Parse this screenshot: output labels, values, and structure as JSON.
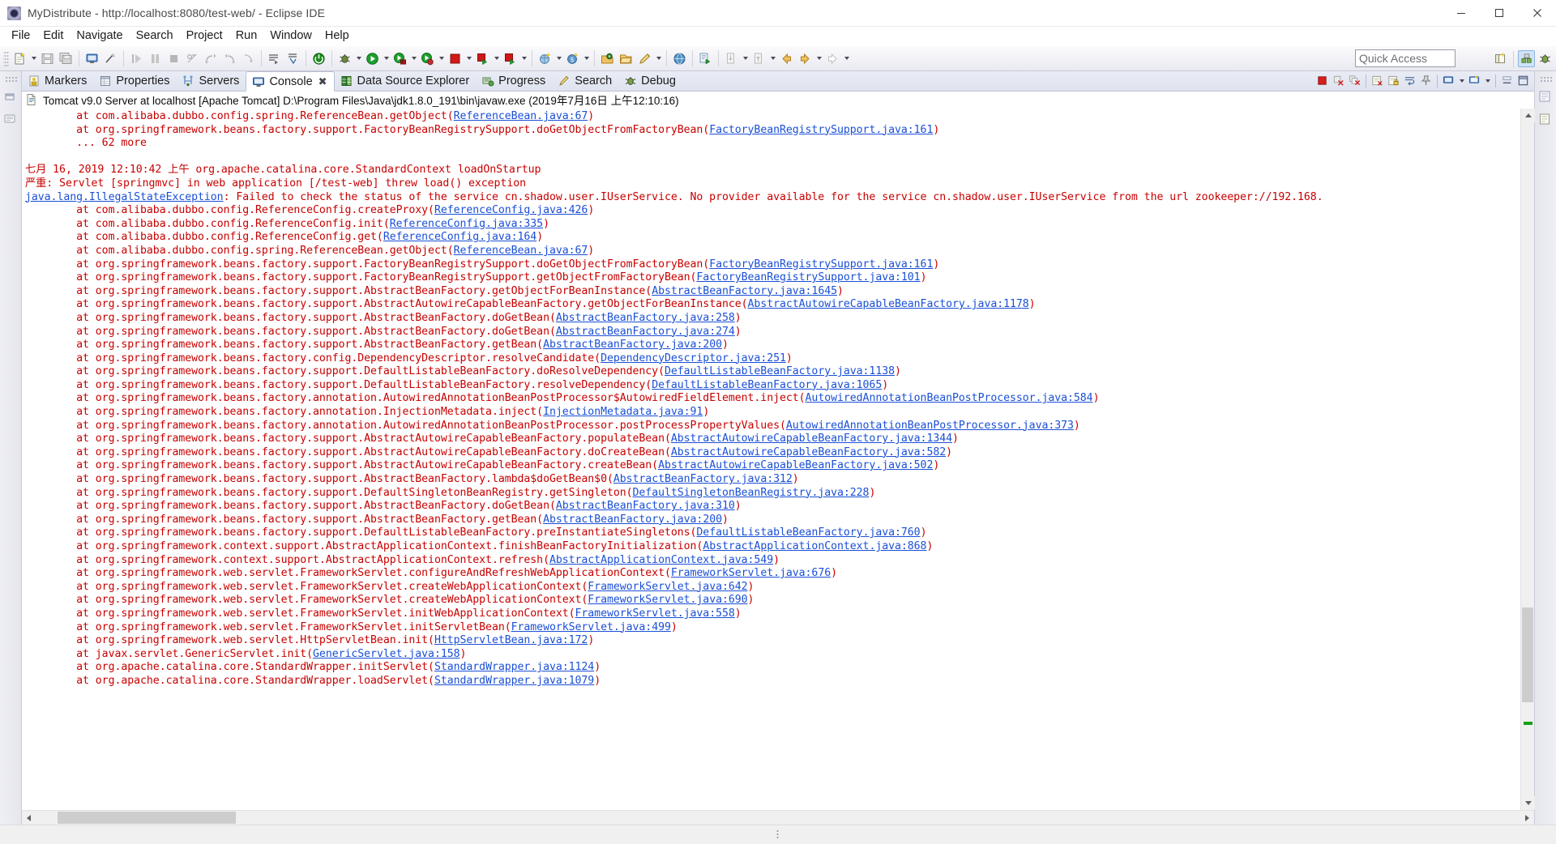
{
  "window": {
    "title": "MyDistribute - http://localhost:8080/test-web/ - Eclipse IDE",
    "icon": "eclipse-icon",
    "minimize_label": "—",
    "maximize_label": "❐",
    "close_label": "✕"
  },
  "menu": {
    "items": [
      {
        "label": "File"
      },
      {
        "label": "Edit"
      },
      {
        "label": "Navigate"
      },
      {
        "label": "Search"
      },
      {
        "label": "Project"
      },
      {
        "label": "Run"
      },
      {
        "label": "Window"
      },
      {
        "label": "Help"
      }
    ]
  },
  "toolbar": {
    "quick_access_placeholder": "Quick Access",
    "quick_access_value": "",
    "groups": [
      {
        "icons": [
          "new-wizard-icon",
          "dropdown-arrow",
          "save-icon",
          "save-all-icon"
        ]
      },
      {
        "icons": [
          "console-icon",
          "no-publish-icon"
        ]
      },
      {
        "icons": [
          "step-into-icon",
          "pause-icon",
          "terminate-icon",
          "skip-breakpoints-icon",
          "step-over-icon",
          "step-return-icon",
          "drop-to-frame-icon"
        ]
      },
      {
        "icons": [
          "open-task-icon",
          "link-task-icon"
        ]
      },
      {
        "icons": [
          "power-server-icon"
        ]
      },
      {
        "icons": [
          "debug-bug-icon",
          "dropdown-arrow",
          "run-green-icon",
          "dropdown-arrow",
          "run-on-server-icon",
          "dropdown-arrow",
          "profile-icon",
          "dropdown-arrow",
          "stop-red-icon",
          "dropdown-arrow",
          "publish-icon",
          "dropdown-arrow",
          "server-run-icon",
          "dropdown-arrow"
        ]
      },
      {
        "icons": [
          "new-java-class-icon",
          "dropdown-arrow",
          "new-dollar-icon",
          "dropdown-arrow"
        ]
      },
      {
        "icons": [
          "open-type-icon",
          "open-folder-icon",
          "pencil-icon",
          "dropdown-arrow"
        ]
      },
      {
        "icons": [
          "web-browser-icon"
        ]
      },
      {
        "icons": [
          "external-tools-icon"
        ]
      },
      {
        "icons": [
          "prev-annotation-icon",
          "dropdown-arrow",
          "next-annotation-icon",
          "dropdown-arrow",
          "back-arrow-icon",
          "forward-arrow-icon",
          "dropdown-arrow",
          "next-edit-icon",
          "dropdown-arrow"
        ]
      }
    ],
    "right_icons": [
      "open-perspective-icon",
      "java-ee-perspective-icon",
      "debug-perspective-icon"
    ]
  },
  "tabs": {
    "items": [
      {
        "label": "Markers",
        "icon": "markers-icon",
        "active": false
      },
      {
        "label": "Properties",
        "icon": "properties-icon",
        "active": false
      },
      {
        "label": "Servers",
        "icon": "servers-icon",
        "active": false
      },
      {
        "label": "Console",
        "icon": "console-view-icon",
        "active": true,
        "close": "✖"
      },
      {
        "label": "Data Source Explorer",
        "icon": "datasource-icon",
        "active": false
      },
      {
        "label": "Progress",
        "icon": "progress-icon",
        "active": false
      },
      {
        "label": "Search",
        "icon": "search-icon",
        "active": false
      },
      {
        "label": "Debug",
        "icon": "debug-icon",
        "active": false
      }
    ],
    "view_toolbar": [
      "terminate-icon",
      "remove-launch-icon",
      "remove-all-terminated-icon",
      "clear-console-icon",
      "scroll-lock-icon",
      "word-wrap-icon",
      "pin-console-icon",
      "display-selected-console-icon",
      "dropdown-arrow",
      "open-console-icon",
      "dropdown-arrow",
      "minimize-icon",
      "maximize-icon"
    ]
  },
  "console": {
    "header": "Tomcat v9.0 Server at localhost [Apache Tomcat] D:\\Program Files\\Java\\jdk1.8.0_191\\bin\\javaw.exe (2019年7月16日 上午12:10:16)",
    "header_icon": "console-document-icon",
    "lines": [
      {
        "indent": 1,
        "segments": [
          {
            "t": "at com.alibaba.dubbo.config.spring.ReferenceBean.getObject("
          },
          {
            "t": "ReferenceBean.java:67",
            "link": true
          },
          {
            "t": ")"
          }
        ]
      },
      {
        "indent": 1,
        "segments": [
          {
            "t": "at org.springframework.beans.factory.support.FactoryBeanRegistrySupport.doGetObjectFromFactoryBean("
          },
          {
            "t": "FactoryBeanRegistrySupport.java:161",
            "link": true
          },
          {
            "t": ")"
          }
        ]
      },
      {
        "indent": 1,
        "segments": [
          {
            "t": "... 62 more"
          }
        ]
      },
      {
        "indent": 0,
        "segments": [
          {
            "t": " "
          }
        ]
      },
      {
        "indent": 0,
        "segments": [
          {
            "t": "七月 16, 2019 12:10:42 上午 org.apache.catalina.core.StandardContext loadOnStartup"
          }
        ]
      },
      {
        "indent": 0,
        "segments": [
          {
            "t": "严重: Servlet [springmvc] in web application [/test-web] threw load() exception"
          }
        ]
      },
      {
        "indent": 0,
        "segments": [
          {
            "t": "java.lang.IllegalStateException",
            "link": true
          },
          {
            "t": ": Failed to check the status of the service cn.shadow.user.IUserService. No provider available for the service cn.shadow.user.IUserService from the url zookeeper://192.168."
          }
        ]
      },
      {
        "indent": 1,
        "segments": [
          {
            "t": "at com.alibaba.dubbo.config.ReferenceConfig.createProxy("
          },
          {
            "t": "ReferenceConfig.java:426",
            "link": true
          },
          {
            "t": ")"
          }
        ]
      },
      {
        "indent": 1,
        "segments": [
          {
            "t": "at com.alibaba.dubbo.config.ReferenceConfig.init("
          },
          {
            "t": "ReferenceConfig.java:335",
            "link": true
          },
          {
            "t": ")"
          }
        ]
      },
      {
        "indent": 1,
        "segments": [
          {
            "t": "at com.alibaba.dubbo.config.ReferenceConfig.get("
          },
          {
            "t": "ReferenceConfig.java:164",
            "link": true
          },
          {
            "t": ")"
          }
        ]
      },
      {
        "indent": 1,
        "segments": [
          {
            "t": "at com.alibaba.dubbo.config.spring.ReferenceBean.getObject("
          },
          {
            "t": "ReferenceBean.java:67",
            "link": true
          },
          {
            "t": ")"
          }
        ]
      },
      {
        "indent": 1,
        "segments": [
          {
            "t": "at org.springframework.beans.factory.support.FactoryBeanRegistrySupport.doGetObjectFromFactoryBean("
          },
          {
            "t": "FactoryBeanRegistrySupport.java:161",
            "link": true
          },
          {
            "t": ")"
          }
        ]
      },
      {
        "indent": 1,
        "segments": [
          {
            "t": "at org.springframework.beans.factory.support.FactoryBeanRegistrySupport.getObjectFromFactoryBean("
          },
          {
            "t": "FactoryBeanRegistrySupport.java:101",
            "link": true
          },
          {
            "t": ")"
          }
        ]
      },
      {
        "indent": 1,
        "segments": [
          {
            "t": "at org.springframework.beans.factory.support.AbstractBeanFactory.getObjectForBeanInstance("
          },
          {
            "t": "AbstractBeanFactory.java:1645",
            "link": true
          },
          {
            "t": ")"
          }
        ]
      },
      {
        "indent": 1,
        "segments": [
          {
            "t": "at org.springframework.beans.factory.support.AbstractAutowireCapableBeanFactory.getObjectForBeanInstance("
          },
          {
            "t": "AbstractAutowireCapableBeanFactory.java:1178",
            "link": true
          },
          {
            "t": ")"
          }
        ]
      },
      {
        "indent": 1,
        "segments": [
          {
            "t": "at org.springframework.beans.factory.support.AbstractBeanFactory.doGetBean("
          },
          {
            "t": "AbstractBeanFactory.java:258",
            "link": true
          },
          {
            "t": ")"
          }
        ]
      },
      {
        "indent": 1,
        "segments": [
          {
            "t": "at org.springframework.beans.factory.support.AbstractBeanFactory.doGetBean("
          },
          {
            "t": "AbstractBeanFactory.java:274",
            "link": true
          },
          {
            "t": ")"
          }
        ]
      },
      {
        "indent": 1,
        "segments": [
          {
            "t": "at org.springframework.beans.factory.support.AbstractBeanFactory.getBean("
          },
          {
            "t": "AbstractBeanFactory.java:200",
            "link": true
          },
          {
            "t": ")"
          }
        ]
      },
      {
        "indent": 1,
        "segments": [
          {
            "t": "at org.springframework.beans.factory.config.DependencyDescriptor.resolveCandidate("
          },
          {
            "t": "DependencyDescriptor.java:251",
            "link": true
          },
          {
            "t": ")"
          }
        ]
      },
      {
        "indent": 1,
        "segments": [
          {
            "t": "at org.springframework.beans.factory.support.DefaultListableBeanFactory.doResolveDependency("
          },
          {
            "t": "DefaultListableBeanFactory.java:1138",
            "link": true
          },
          {
            "t": ")"
          }
        ]
      },
      {
        "indent": 1,
        "segments": [
          {
            "t": "at org.springframework.beans.factory.support.DefaultListableBeanFactory.resolveDependency("
          },
          {
            "t": "DefaultListableBeanFactory.java:1065",
            "link": true
          },
          {
            "t": ")"
          }
        ]
      },
      {
        "indent": 1,
        "segments": [
          {
            "t": "at org.springframework.beans.factory.annotation.AutowiredAnnotationBeanPostProcessor$AutowiredFieldElement.inject("
          },
          {
            "t": "AutowiredAnnotationBeanPostProcessor.java:584",
            "link": true
          },
          {
            "t": ")"
          }
        ]
      },
      {
        "indent": 1,
        "segments": [
          {
            "t": "at org.springframework.beans.factory.annotation.InjectionMetadata.inject("
          },
          {
            "t": "InjectionMetadata.java:91",
            "link": true
          },
          {
            "t": ")"
          }
        ]
      },
      {
        "indent": 1,
        "segments": [
          {
            "t": "at org.springframework.beans.factory.annotation.AutowiredAnnotationBeanPostProcessor.postProcessPropertyValues("
          },
          {
            "t": "AutowiredAnnotationBeanPostProcessor.java:373",
            "link": true
          },
          {
            "t": ")"
          }
        ]
      },
      {
        "indent": 1,
        "segments": [
          {
            "t": "at org.springframework.beans.factory.support.AbstractAutowireCapableBeanFactory.populateBean("
          },
          {
            "t": "AbstractAutowireCapableBeanFactory.java:1344",
            "link": true
          },
          {
            "t": ")"
          }
        ]
      },
      {
        "indent": 1,
        "segments": [
          {
            "t": "at org.springframework.beans.factory.support.AbstractAutowireCapableBeanFactory.doCreateBean("
          },
          {
            "t": "AbstractAutowireCapableBeanFactory.java:582",
            "link": true
          },
          {
            "t": ")"
          }
        ]
      },
      {
        "indent": 1,
        "segments": [
          {
            "t": "at org.springframework.beans.factory.support.AbstractAutowireCapableBeanFactory.createBean("
          },
          {
            "t": "AbstractAutowireCapableBeanFactory.java:502",
            "link": true
          },
          {
            "t": ")"
          }
        ]
      },
      {
        "indent": 1,
        "segments": [
          {
            "t": "at org.springframework.beans.factory.support.AbstractBeanFactory.lambda$doGetBean$0("
          },
          {
            "t": "AbstractBeanFactory.java:312",
            "link": true
          },
          {
            "t": ")"
          }
        ]
      },
      {
        "indent": 1,
        "segments": [
          {
            "t": "at org.springframework.beans.factory.support.DefaultSingletonBeanRegistry.getSingleton("
          },
          {
            "t": "DefaultSingletonBeanRegistry.java:228",
            "link": true
          },
          {
            "t": ")"
          }
        ]
      },
      {
        "indent": 1,
        "segments": [
          {
            "t": "at org.springframework.beans.factory.support.AbstractBeanFactory.doGetBean("
          },
          {
            "t": "AbstractBeanFactory.java:310",
            "link": true
          },
          {
            "t": ")"
          }
        ]
      },
      {
        "indent": 1,
        "segments": [
          {
            "t": "at org.springframework.beans.factory.support.AbstractBeanFactory.getBean("
          },
          {
            "t": "AbstractBeanFactory.java:200",
            "link": true
          },
          {
            "t": ")"
          }
        ]
      },
      {
        "indent": 1,
        "segments": [
          {
            "t": "at org.springframework.beans.factory.support.DefaultListableBeanFactory.preInstantiateSingletons("
          },
          {
            "t": "DefaultListableBeanFactory.java:760",
            "link": true
          },
          {
            "t": ")"
          }
        ]
      },
      {
        "indent": 1,
        "segments": [
          {
            "t": "at org.springframework.context.support.AbstractApplicationContext.finishBeanFactoryInitialization("
          },
          {
            "t": "AbstractApplicationContext.java:868",
            "link": true
          },
          {
            "t": ")"
          }
        ]
      },
      {
        "indent": 1,
        "segments": [
          {
            "t": "at org.springframework.context.support.AbstractApplicationContext.refresh("
          },
          {
            "t": "AbstractApplicationContext.java:549",
            "link": true
          },
          {
            "t": ")"
          }
        ]
      },
      {
        "indent": 1,
        "segments": [
          {
            "t": "at org.springframework.web.servlet.FrameworkServlet.configureAndRefreshWebApplicationContext("
          },
          {
            "t": "FrameworkServlet.java:676",
            "link": true
          },
          {
            "t": ")"
          }
        ]
      },
      {
        "indent": 1,
        "segments": [
          {
            "t": "at org.springframework.web.servlet.FrameworkServlet.createWebApplicationContext("
          },
          {
            "t": "FrameworkServlet.java:642",
            "link": true
          },
          {
            "t": ")"
          }
        ]
      },
      {
        "indent": 1,
        "segments": [
          {
            "t": "at org.springframework.web.servlet.FrameworkServlet.createWebApplicationContext("
          },
          {
            "t": "FrameworkServlet.java:690",
            "link": true
          },
          {
            "t": ")"
          }
        ]
      },
      {
        "indent": 1,
        "segments": [
          {
            "t": "at org.springframework.web.servlet.FrameworkServlet.initWebApplicationContext("
          },
          {
            "t": "FrameworkServlet.java:558",
            "link": true
          },
          {
            "t": ")"
          }
        ]
      },
      {
        "indent": 1,
        "segments": [
          {
            "t": "at org.springframework.web.servlet.FrameworkServlet.initServletBean("
          },
          {
            "t": "FrameworkServlet.java:499",
            "link": true
          },
          {
            "t": ")"
          }
        ]
      },
      {
        "indent": 1,
        "segments": [
          {
            "t": "at org.springframework.web.servlet.HttpServletBean.init("
          },
          {
            "t": "HttpServletBean.java:172",
            "link": true
          },
          {
            "t": ")"
          }
        ]
      },
      {
        "indent": 1,
        "segments": [
          {
            "t": "at javax.servlet.GenericServlet.init("
          },
          {
            "t": "GenericServlet.java:158",
            "link": true
          },
          {
            "t": ")"
          }
        ]
      },
      {
        "indent": 1,
        "segments": [
          {
            "t": "at org.apache.catalina.core.StandardWrapper.initServlet("
          },
          {
            "t": "StandardWrapper.java:1124",
            "link": true
          },
          {
            "t": ")"
          }
        ]
      },
      {
        "indent": 1,
        "clipped": true,
        "segments": [
          {
            "t": "at org.apache.catalina.core.StandardWrapper.loadServlet("
          },
          {
            "t": "StandardWrapper.java:1079",
            "link": true
          },
          {
            "t": ")"
          }
        ]
      }
    ]
  },
  "scrollbars": {
    "vertical": {
      "thumb_top_pct": 72,
      "thumb_height_pct": 14,
      "marker_top_pct": 89
    },
    "horizontal": {
      "thumb_left_pct": 1.5,
      "thumb_width_pct": 12
    }
  },
  "colors": {
    "error_text": "#c80000",
    "link": "#1a4fd6",
    "tab_active_bg": "#ffffff",
    "toolbar_bg": "#f2f2f7",
    "scroll_marker_green": "#16a016"
  }
}
